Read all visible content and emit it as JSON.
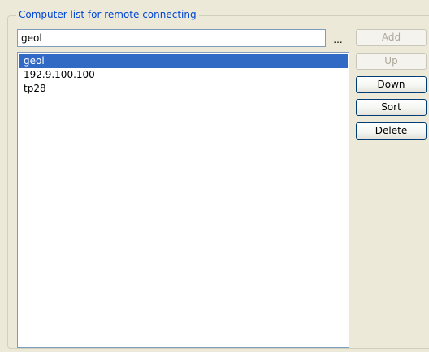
{
  "group": {
    "title": "Computer list for remote connecting"
  },
  "input": {
    "value": "geol"
  },
  "browse_label": "...",
  "list": {
    "items": [
      "geol",
      "192.9.100.100",
      "tp28"
    ],
    "selected_index": 0
  },
  "buttons": {
    "add": {
      "label": "Add",
      "enabled": false
    },
    "up": {
      "label": "Up",
      "enabled": false
    },
    "down": {
      "label": "Down",
      "enabled": true
    },
    "sort": {
      "label": "Sort",
      "enabled": true
    },
    "delete": {
      "label": "Delete",
      "enabled": true
    }
  },
  "colors": {
    "selection": "#316ac5",
    "legend_text": "#0046d5",
    "panel_bg": "#ece9d8"
  }
}
